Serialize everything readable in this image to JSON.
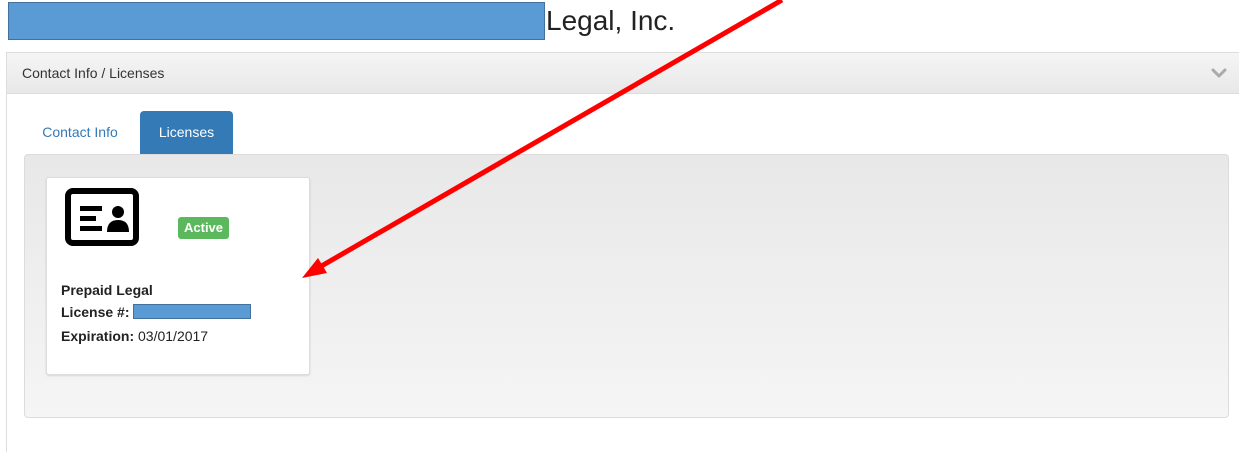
{
  "header": {
    "company_name": "Legal, Inc."
  },
  "panel": {
    "title": "Contact Info / Licenses",
    "collapse_icon": "chevron-down-icon"
  },
  "tabs": [
    {
      "label": "Contact Info",
      "active": false
    },
    {
      "label": "Licenses",
      "active": true
    }
  ],
  "license_card": {
    "icon": "id-card-icon",
    "status": "Active",
    "type": "Prepaid Legal",
    "license_label": "License #:",
    "expiration_label": "Expiration:",
    "expiration_value": "03/01/2017"
  },
  "colors": {
    "accent": "#337ab7",
    "status_active": "#5cb85c",
    "redaction": "#5b9bd5",
    "annotation_arrow": "#ff0000"
  }
}
